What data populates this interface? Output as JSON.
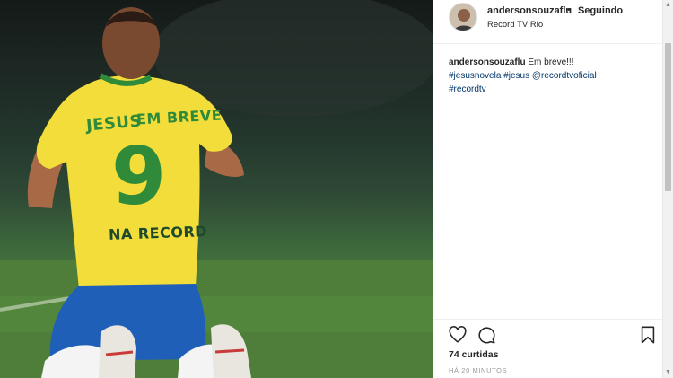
{
  "post": {
    "photo_texts": {
      "line1_a": "JESUS",
      "line1_b": "EM BREVE",
      "number": "9",
      "line2": "NA RECORD"
    }
  },
  "header": {
    "username": "andersonsouzaflu",
    "separator": "•",
    "follow_status": "Seguindo",
    "location": "Record TV Rio"
  },
  "caption": {
    "username": "andersonsouzaflu",
    "text": "Em breve!!!",
    "tags": [
      "#jesusnovela",
      "#jesus",
      "@recordtvoficial",
      "#recordtv"
    ]
  },
  "actions": {
    "icons": [
      "heart-icon",
      "comment-icon",
      "bookmark-icon"
    ]
  },
  "likes": "74 curtidas",
  "timestamp": "HÁ 20 MINUTOS",
  "colors": {
    "link": "#003569",
    "jersey_yellow": "#f2dd3a",
    "jersey_green": "#2f8a3a",
    "shorts_blue": "#1f5fb8"
  }
}
